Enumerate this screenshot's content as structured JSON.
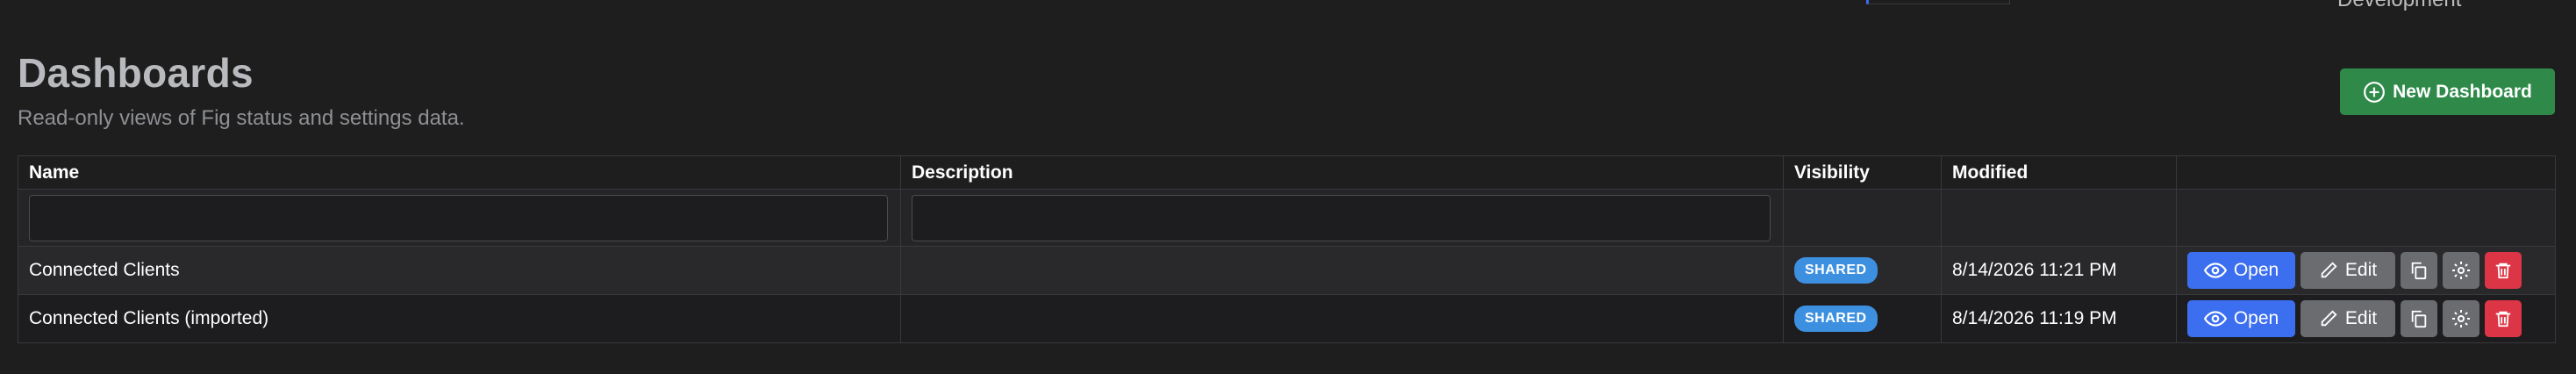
{
  "top_fragment": {
    "text": "Development"
  },
  "page": {
    "title": "Dashboards",
    "subtitle": "Read-only views of Fig status and settings data.",
    "new_button_label": "New Dashboard"
  },
  "table": {
    "columns": [
      "Name",
      "Description",
      "Visibility",
      "Modified",
      ""
    ],
    "filters": {
      "name_value": "",
      "description_value": ""
    },
    "rows": [
      {
        "name": "Connected Clients",
        "description": "",
        "visibility": "SHARED",
        "modified": "8/14/2026 11:21 PM",
        "open_label": "Open",
        "edit_label": "Edit"
      },
      {
        "name": "Connected Clients (imported)",
        "description": "",
        "visibility": "SHARED",
        "modified": "8/14/2026 11:19 PM",
        "open_label": "Open",
        "edit_label": "Edit"
      }
    ]
  },
  "icons": {
    "new": "plus-circle-icon",
    "open": "eye-icon",
    "edit": "pencil-icon",
    "copy": "copy-icon",
    "settings": "gear-icon",
    "delete": "trash-icon"
  },
  "colors": {
    "background": "#1e1e1f",
    "primary": "#3c6ff0",
    "success": "#2f8a4a",
    "danger": "#dc3545",
    "badge": "#3d8fe0",
    "secondary": "#6b6c70"
  }
}
